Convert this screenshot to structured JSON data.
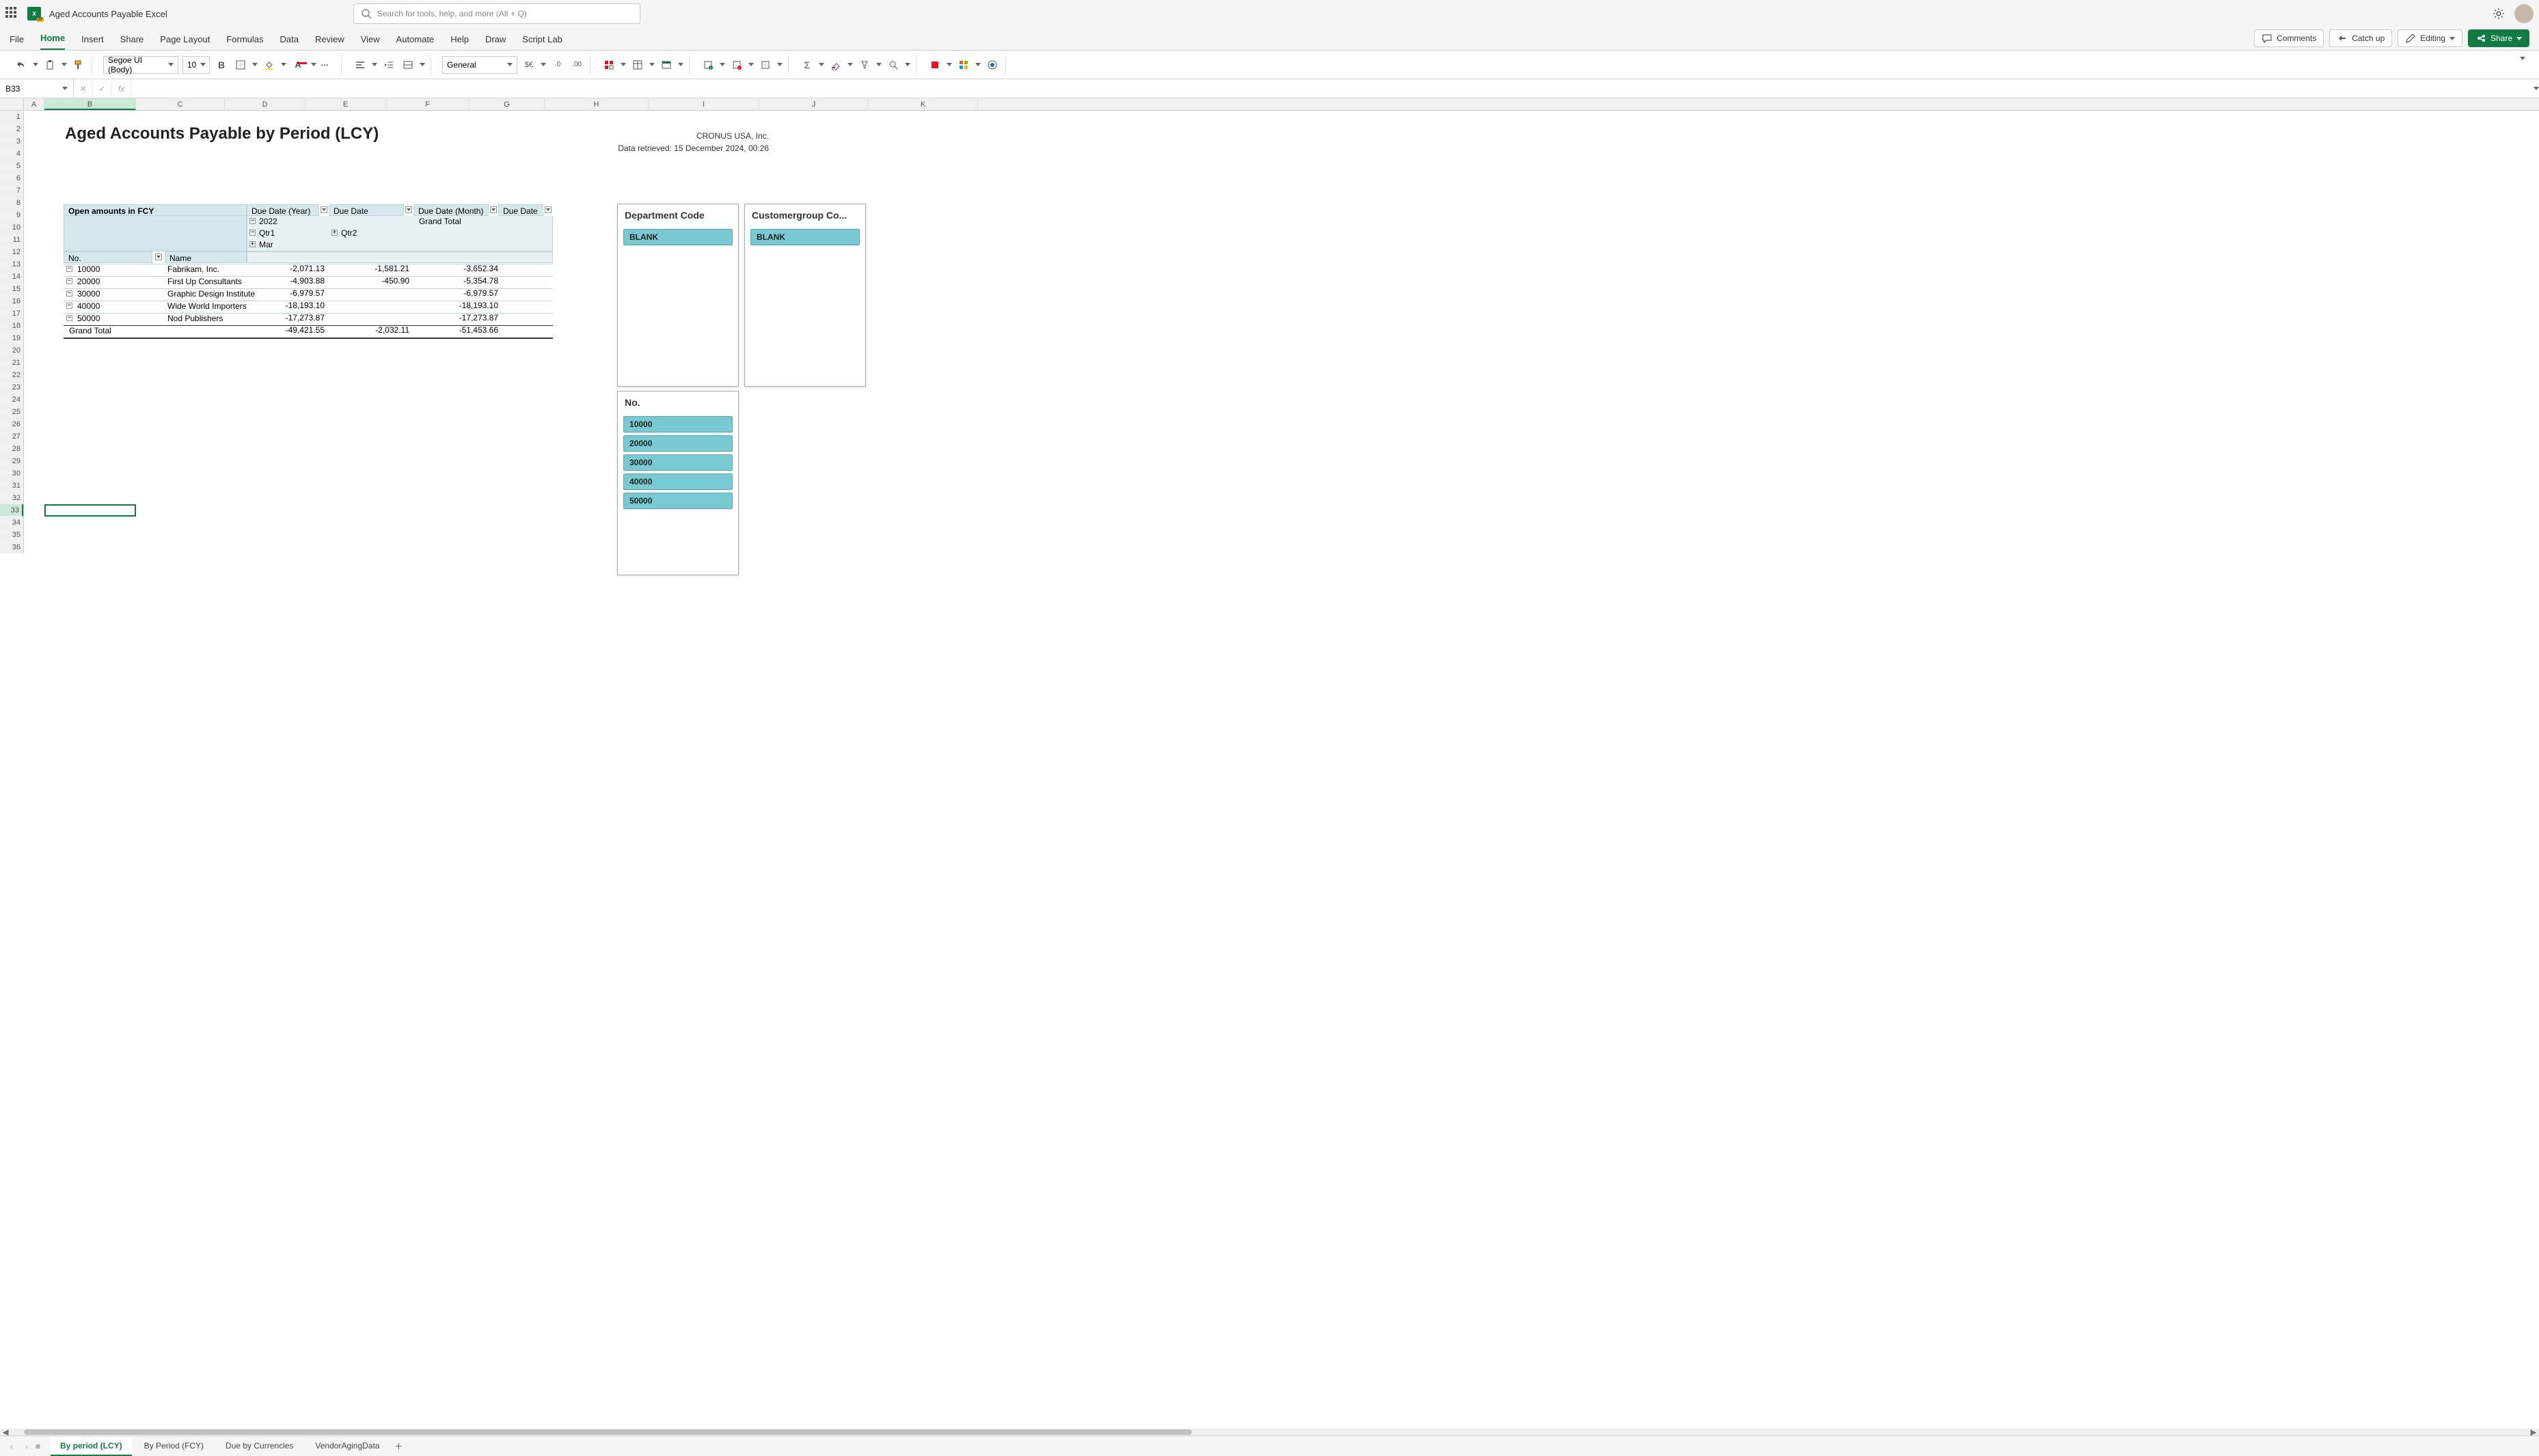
{
  "titlebar": {
    "doc_title": "Aged Accounts Payable Excel",
    "search_placeholder": "Search for tools, help, and more (Alt + Q)"
  },
  "ribbon": {
    "tabs": [
      "File",
      "Home",
      "Insert",
      "Share",
      "Page Layout",
      "Formulas",
      "Data",
      "Review",
      "View",
      "Automate",
      "Help",
      "Draw",
      "Script Lab"
    ],
    "active_tab": "Home",
    "comments": "Comments",
    "catch_up": "Catch up",
    "editing": "Editing",
    "share": "Share"
  },
  "toolbar": {
    "font_name": "Segoe UI (Body)",
    "font_size": "10",
    "number_format": "General"
  },
  "formula_bar": {
    "name_box": "B33",
    "formula": ""
  },
  "columns": [
    {
      "label": "A",
      "width": 30
    },
    {
      "label": "B",
      "width": 134
    },
    {
      "label": "C",
      "width": 130
    },
    {
      "label": "D",
      "width": 118
    },
    {
      "label": "E",
      "width": 118
    },
    {
      "label": "F",
      "width": 122
    },
    {
      "label": "G",
      "width": 110
    },
    {
      "label": "H",
      "width": 152
    },
    {
      "label": "I",
      "width": 162
    },
    {
      "label": "J",
      "width": 160
    },
    {
      "label": "K",
      "width": 160
    }
  ],
  "row_count": 36,
  "selected_cell": {
    "col": "B",
    "row": 33
  },
  "sheet": {
    "title": "Aged Accounts Payable by Period (LCY)",
    "company": "CRONUS USA, Inc.",
    "retrieved": "Data retrieved: 15 December 2024, 00:26"
  },
  "pivot": {
    "measure_label": "Open amounts in FCY",
    "col_fields": [
      "Due Date (Year)",
      "Due Date (Quarter)",
      "Due Date (Month)",
      "Due Date"
    ],
    "row_fields": [
      "No.",
      "Name"
    ],
    "year": "2022",
    "quarters": [
      "Qtr1",
      "Qtr2"
    ],
    "month": "Mar",
    "grand_total_col_label": "Grand Total",
    "grand_total_row_label": "Grand Total",
    "rows": [
      {
        "no": "10000",
        "name": "Fabrikam, Inc.",
        "d": "-2,071.13",
        "e": "-1,581.21",
        "f": "-3,652.34"
      },
      {
        "no": "20000",
        "name": "First Up Consultants",
        "d": "-4,903.88",
        "e": "-450.90",
        "f": "-5,354.78"
      },
      {
        "no": "30000",
        "name": "Graphic Design Institute",
        "d": "-6,979.57",
        "e": "",
        "f": "-6,979.57"
      },
      {
        "no": "40000",
        "name": "Wide World Importers",
        "d": "-18,193.10",
        "e": "",
        "f": "-18,193.10"
      },
      {
        "no": "50000",
        "name": "Nod Publishers",
        "d": "-17,273.87",
        "e": "",
        "f": "-17,273.87"
      }
    ],
    "grand_total": {
      "d": "-49,421.55",
      "e": "-2,032.11",
      "f": "-51,453.66"
    }
  },
  "slicers": {
    "dept": {
      "title": "Department Code",
      "items": [
        "BLANK"
      ]
    },
    "custgroup": {
      "title": "Customergroup Co...",
      "items": [
        "BLANK"
      ]
    },
    "no": {
      "title": "No.",
      "items": [
        "10000",
        "20000",
        "30000",
        "40000",
        "50000"
      ]
    }
  },
  "sheets": {
    "tabs": [
      "By period (LCY)",
      "By Period (FCY)",
      "Due by Currencies",
      "VendorAgingData"
    ],
    "active": "By period (LCY)"
  }
}
